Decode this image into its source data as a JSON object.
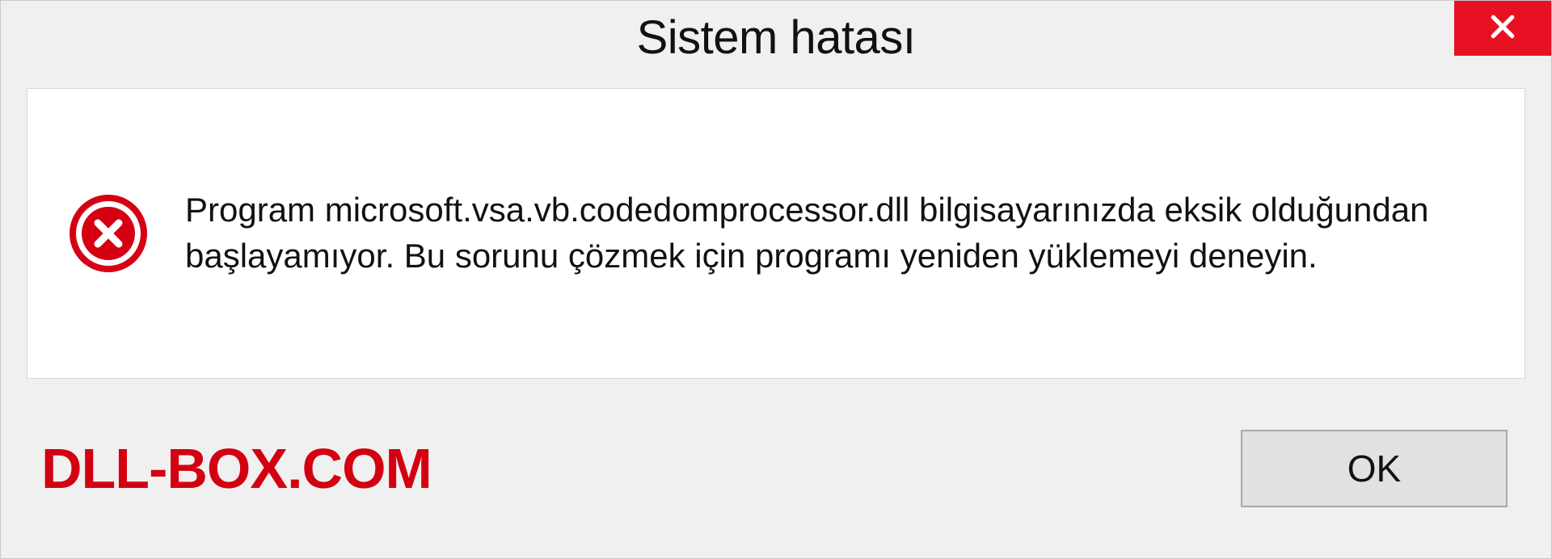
{
  "titlebar": {
    "title": "Sistem hatası"
  },
  "content": {
    "message": "Program microsoft.vsa.vb.codedomprocessor.dll bilgisayarınızda eksik olduğundan başlayamıyor. Bu sorunu çözmek için programı yeniden yüklemeyi deneyin."
  },
  "footer": {
    "watermark": "DLL-BOX.COM",
    "ok_label": "OK"
  },
  "colors": {
    "close_button": "#e81123",
    "error_icon": "#d60013",
    "watermark": "#d30011"
  }
}
